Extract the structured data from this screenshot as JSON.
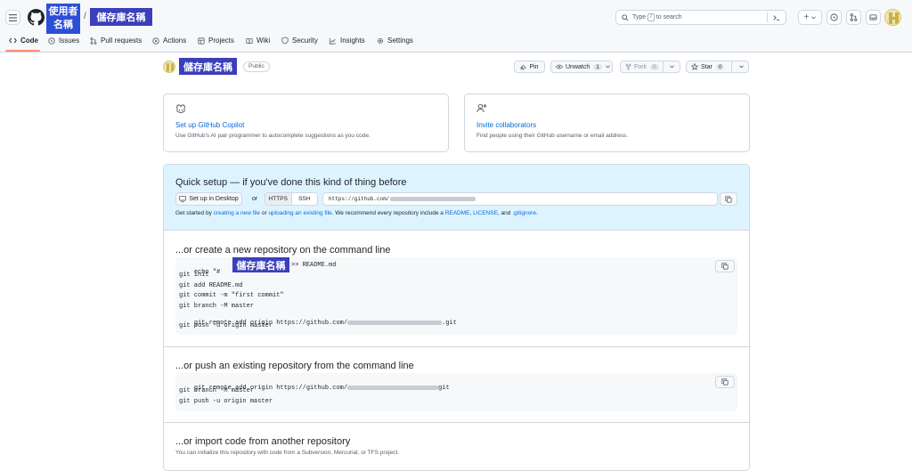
{
  "header": {
    "owner_label_line1": "使用者",
    "owner_label_line2": "名稱",
    "separator": "/",
    "repo_label": "儲存庫名稱",
    "search_placeholder_pre": "Type",
    "search_key": "/",
    "search_placeholder_post": "to search",
    "plus_label": "+"
  },
  "nav": {
    "tabs": [
      {
        "label": "Code",
        "icon": "code-icon"
      },
      {
        "label": "Issues",
        "icon": "issue-icon"
      },
      {
        "label": "Pull requests",
        "icon": "pull-request-icon"
      },
      {
        "label": "Actions",
        "icon": "play-icon"
      },
      {
        "label": "Projects",
        "icon": "table-icon"
      },
      {
        "label": "Wiki",
        "icon": "book-icon"
      },
      {
        "label": "Security",
        "icon": "shield-icon"
      },
      {
        "label": "Insights",
        "icon": "graph-icon"
      },
      {
        "label": "Settings",
        "icon": "gear-icon"
      }
    ]
  },
  "repo": {
    "name_label": "儲存庫名稱",
    "visibility": "Public",
    "pin_label": "Pin",
    "unwatch_label": "Unwatch",
    "unwatch_count": "1",
    "fork_label": "Fork",
    "fork_count": "0",
    "star_label": "Star",
    "star_count": "0"
  },
  "cards": {
    "copilot_title": "Set up GitHub Copilot",
    "copilot_desc": "Use GitHub's AI pair programmer to autocomplete suggestions as you code.",
    "collab_title": "Invite collaborators",
    "collab_desc": "Find people using their GitHub username or email address."
  },
  "quick_setup": {
    "title": "Quick setup — if you've done this kind of thing before",
    "desktop_label": "Set up in Desktop",
    "or_label": "or",
    "https_label": "HTTPS",
    "ssh_label": "SSH",
    "url_prefix": "https://github.com/",
    "hint_1": "Get started by ",
    "hint_link_1": "creating a new file",
    "hint_2": " or ",
    "hint_link_2": "uploading an existing file",
    "hint_3": ". We recommend every repository include a ",
    "hint_link_3": "README",
    "hint_4": ", ",
    "hint_link_4": "LICENSE",
    "hint_5": ", and ",
    "hint_link_5": ".gitignore",
    "hint_6": "."
  },
  "create_section": {
    "title": "...or create a new repository on the command line",
    "line1_pre": "echo \"#",
    "line1_callout": "儲存庫名稱",
    "line1_post": ">> README.md",
    "lines": [
      "git init",
      "git add README.md",
      "git commit -m \"first commit\"",
      "git branch -M master"
    ],
    "remote_pre": "git remote add origin https://github.com/",
    "remote_post": ".git",
    "push": "git push -u origin master"
  },
  "push_section": {
    "title": "...or push an existing repository from the command line",
    "remote_pre": "git remote add origin https://github.com/",
    "remote_post": "git",
    "branch": "git branch -M master",
    "push": "git push -u origin master"
  },
  "import_section": {
    "title": "...or import code from another repository",
    "desc": "You can initialize this repository with code from a Subversion, Mercurial, or TFS project."
  },
  "colors": {
    "callout": "#2d4fd6",
    "link": "#0969da",
    "active_tab_underline": "#fd8c73",
    "quick_setup_bg": "#ddf4ff"
  }
}
